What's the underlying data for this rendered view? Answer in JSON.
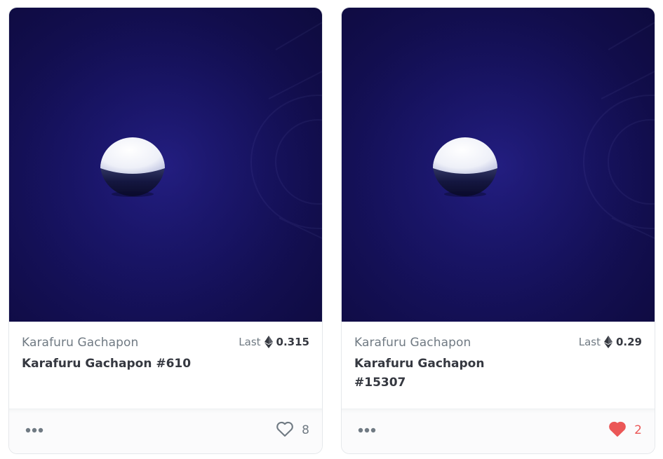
{
  "cards": [
    {
      "collection": "Karafuru Gachapon",
      "title": "Karafuru Gachapon #610",
      "price_label": "Last",
      "price_value": "0.315",
      "currency_icon": "ethereum-icon",
      "likes": "8",
      "liked": false,
      "more_icon": "more-options-icon",
      "image_alt": "gachapon capsule on dark blue background"
    },
    {
      "collection": "Karafuru Gachapon",
      "title": "Karafuru Gachapon #15307",
      "price_label": "Last",
      "price_value": "0.29",
      "currency_icon": "ethereum-icon",
      "likes": "2",
      "liked": true,
      "more_icon": "more-options-icon",
      "image_alt": "gachapon capsule on dark blue background"
    }
  ],
  "colors": {
    "accent_red": "#eb5757",
    "text_dark": "#353840",
    "text_muted": "#707a83",
    "image_bg": "#16125e"
  }
}
